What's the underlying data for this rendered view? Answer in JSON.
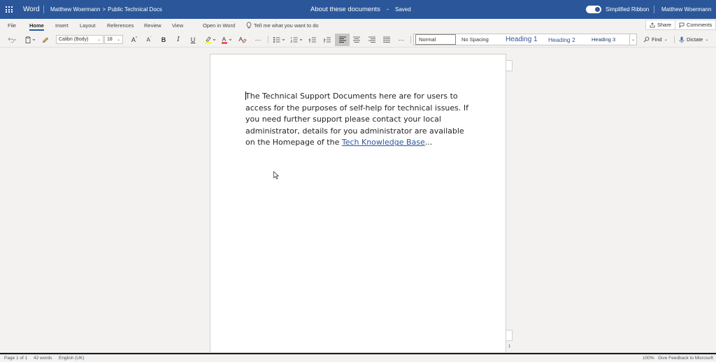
{
  "titlebar": {
    "app_name": "Word",
    "breadcrumb_owner": "Matthew Woermann",
    "breadcrumb_separator": ">",
    "breadcrumb_folder": "Public Technical Docs",
    "document_title": "About these documents",
    "title_separator": "-",
    "save_status": "Saved",
    "simplified_ribbon_label": "Simplified Ribbon",
    "simplified_ribbon_on": true,
    "user_name": "Matthew Woermann",
    "brand_color": "#2b579a"
  },
  "menu": {
    "tabs": [
      "File",
      "Home",
      "Insert",
      "Layout",
      "References",
      "Review",
      "View"
    ],
    "active_tab": "Home",
    "open_in_word": "Open in Word",
    "tell_me": "Tell me what you want to do",
    "share_label": "Share",
    "comments_label": "Comments"
  },
  "ribbon": {
    "font_name": "Calibri (Body)",
    "font_size": "18",
    "styles": {
      "normal": "Normal",
      "no_spacing": "No Spacing",
      "heading1": "Heading 1",
      "heading2": "Heading 2",
      "heading3": "Heading 3"
    },
    "find_label": "Find",
    "dictate_label": "Dictate"
  },
  "document": {
    "text_before_link": "The Technical Support Documents here are for users to access for the purposes of self-help for technical issues. If you need further support please contact your local administrator, details for you administrator are available on the Homepage of the ",
    "link_text": "Tech Knowledge Base",
    "text_after_link": "...",
    "page_number": "1"
  },
  "status": {
    "page_info": "Page 1 of 1",
    "word_count": "42 words",
    "language": "English (UK)",
    "zoom": "100%",
    "feedback": "Give Feedback to Microsoft"
  }
}
